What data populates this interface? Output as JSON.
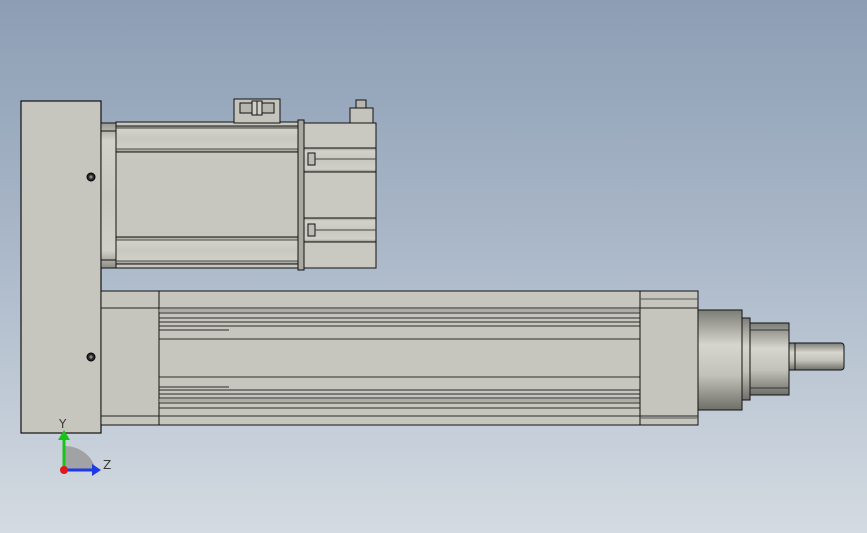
{
  "triad": {
    "y_label": "Y",
    "z_label": "Z",
    "colors": {
      "y": "#19c419",
      "z": "#1f39e6",
      "x": "#e01818",
      "label": "#3a3a3a"
    }
  },
  "palette": {
    "metal": "#c5c5bd",
    "metal_dark": "#8e8e87",
    "metal_light": "#e1e1da",
    "edge": "#101010",
    "groove": "#6d6d66"
  }
}
